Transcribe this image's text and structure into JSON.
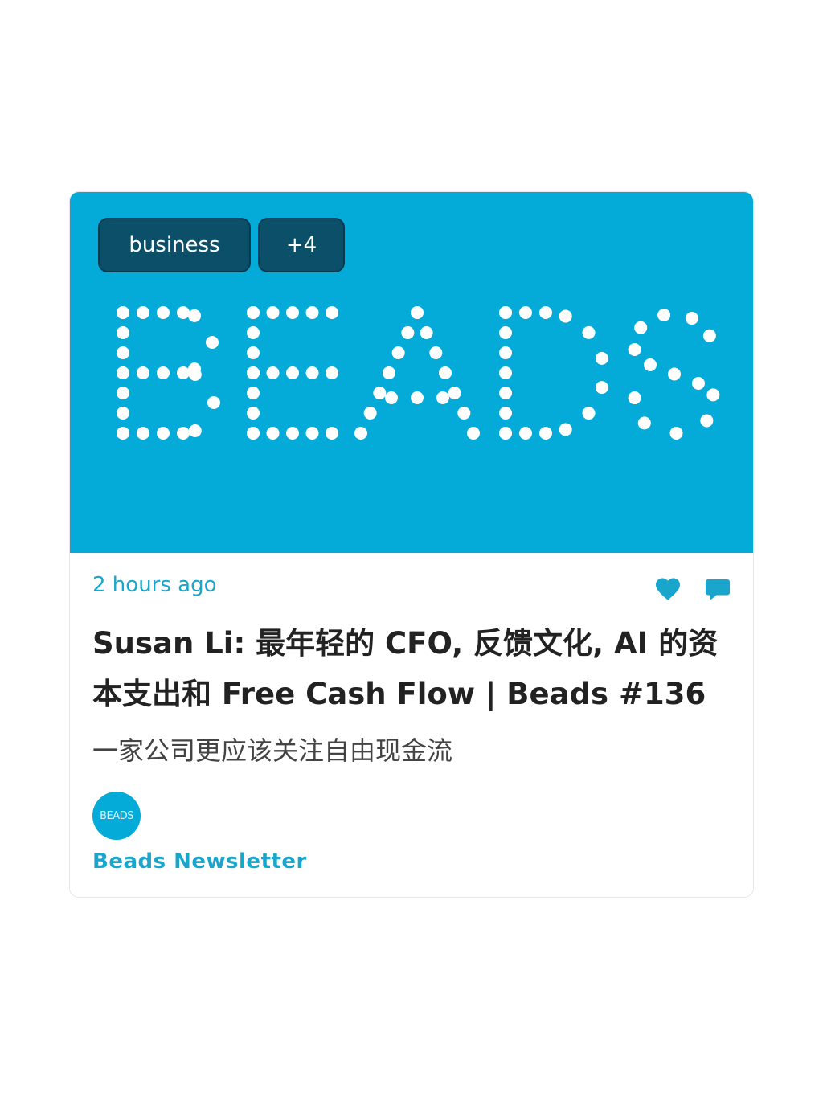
{
  "card": {
    "tags": [
      "business",
      "+4"
    ],
    "hero_logo_text": "BEADS",
    "timestamp": "2 hours ago",
    "title": "Susan Li: 最年轻的 CFO, 反馈文化, AI 的资本支出和 Free Cash Flow | Beads #136",
    "subtitle": "一家公司更应该关注自由现金流",
    "author": {
      "avatar_text": "BEADS",
      "name": "Beads Newsletter"
    },
    "icons": [
      "heart-icon",
      "comment-icon"
    ]
  },
  "colors": {
    "hero_bg": "#04ABD8",
    "tag_bg": "#0C4F68",
    "accent": "#1AA6CC",
    "title_text": "#222222"
  }
}
